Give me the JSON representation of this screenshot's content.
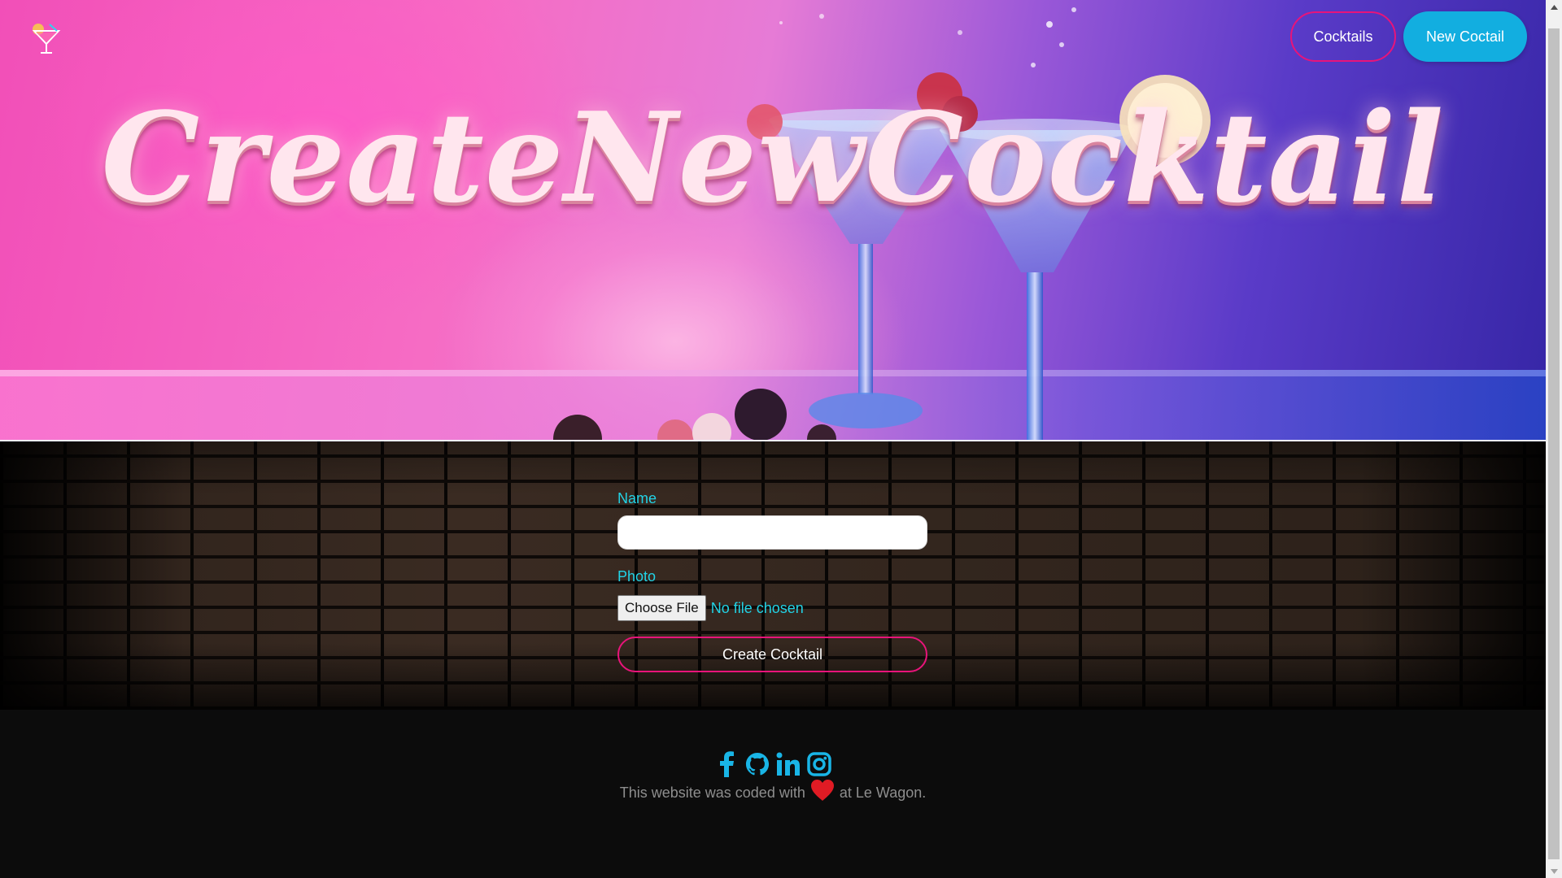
{
  "hero": {
    "title": "CreateNewCocktail",
    "logo_icon": "cocktail-glass-icon"
  },
  "nav": {
    "cocktails_label": "Cocktails",
    "new_cocktail_label": "New Coctail"
  },
  "form": {
    "name_label": "Name",
    "name_value": "",
    "photo_label": "Photo",
    "file_button_label": "Choose File",
    "file_status": "No file chosen",
    "submit_label": "Create Cocktail"
  },
  "footer": {
    "social_icons": [
      "facebook-icon",
      "github-icon",
      "linkedin-icon",
      "instagram-icon"
    ],
    "credit_prefix": "This website was coded with",
    "credit_suffix": "at Le Wagon."
  },
  "colors": {
    "accent_pink": "#e8147a",
    "accent_cyan": "#22d3e6",
    "button_blue": "#12aee0",
    "heart_red": "#e01b24"
  }
}
